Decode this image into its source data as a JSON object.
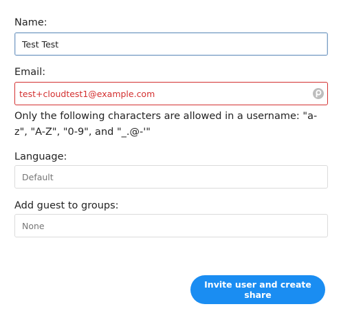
{
  "form": {
    "name_label": "Name:",
    "name_value": "Test Test",
    "email_label": "Email:",
    "email_value": "test+cloudtest1@example.com",
    "email_hint": "Only the following characters are allowed in a username: \"a-z\", \"A-Z\", \"0-9\", and \"_.@-'\"",
    "language_label": "Language:",
    "language_value": "Default",
    "groups_label": "Add guest to groups:",
    "groups_value": "None"
  },
  "actions": {
    "submit_label": "Invite user and create share"
  },
  "icons": {
    "email_field_icon": "password-manager-icon"
  },
  "colors": {
    "accent": "#1a8df2",
    "error": "#d32f2f",
    "active_border": "#7c9fc4"
  }
}
